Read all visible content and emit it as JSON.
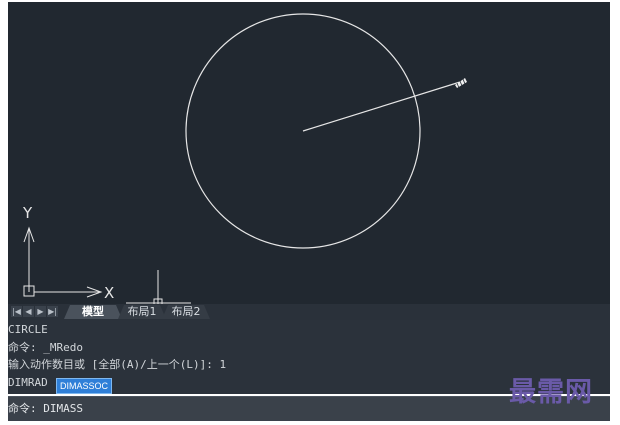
{
  "viewport": {
    "background_color": "#212830",
    "drawing_color": "#e8e8e8",
    "ucs": {
      "x_label": "X",
      "y_label": "Y"
    }
  },
  "tabs": {
    "nav_buttons": [
      "|◀",
      "◀",
      "▶",
      "▶|"
    ],
    "items": [
      {
        "label": "模型",
        "active": true
      },
      {
        "label": "布局1",
        "active": false
      },
      {
        "label": "布局2",
        "active": false
      }
    ]
  },
  "command_history": {
    "lines": [
      "CIRCLE",
      "命令: _MRedo",
      "输入动作数目或 [全部(A)/上一个(L)]: 1",
      "DIMRAD"
    ],
    "autocomplete_suggestion": "DIMASSOC"
  },
  "command_input": {
    "value": "命令: DIMASS"
  },
  "watermark": {
    "text": "最需网"
  }
}
